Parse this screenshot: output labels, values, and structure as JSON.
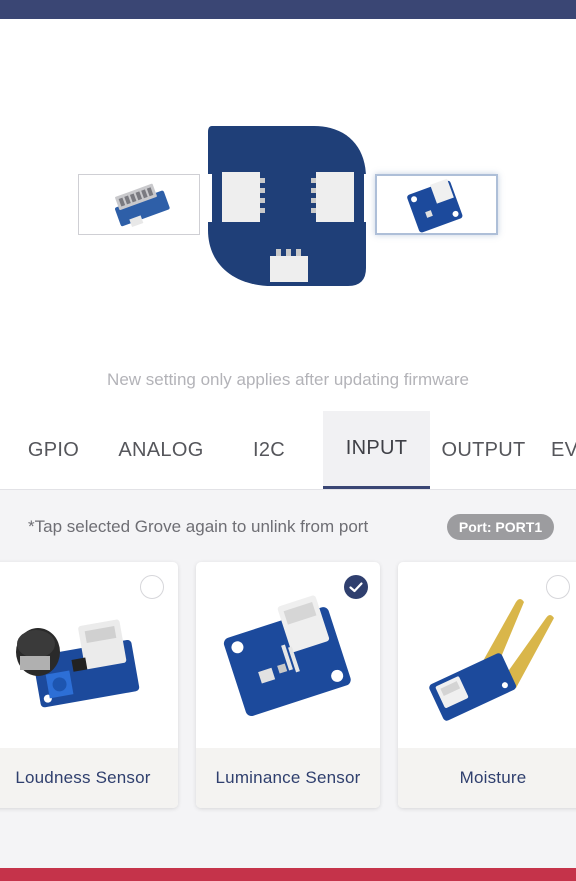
{
  "config": {
    "notice": "New setting only applies after updating firmware"
  },
  "tabs": [
    {
      "label": "GPIO",
      "active": false
    },
    {
      "label": "ANALOG",
      "active": false
    },
    {
      "label": "I2C",
      "active": false
    },
    {
      "label": "INPUT",
      "active": true
    },
    {
      "label": "OUTPUT",
      "active": false
    },
    {
      "label": "EV",
      "active": false
    }
  ],
  "hint": "*Tap selected Grove again to unlink from port",
  "port_badge": "Port: PORT1",
  "sensors": [
    {
      "label": "Loudness Sensor",
      "selected": false,
      "icon": "microphone-module-icon"
    },
    {
      "label": "Luminance Sensor",
      "selected": true,
      "icon": "light-sensor-module-icon"
    },
    {
      "label": "Moisture",
      "selected": false,
      "icon": "soil-moisture-probe-icon"
    }
  ],
  "colors": {
    "header": "#3a4674",
    "accent": "#2f3f6e",
    "hub": "#1f3f78",
    "bottom_bar": "#c5334a",
    "badge": "#9c9c9f"
  }
}
